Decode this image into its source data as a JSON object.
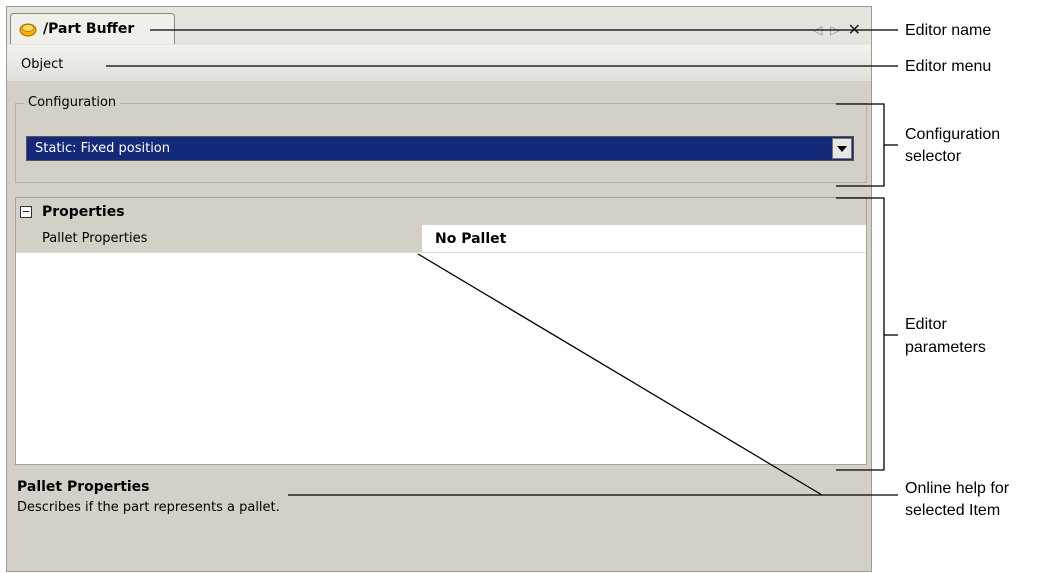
{
  "editor": {
    "tab_title": "/Part Buffer",
    "tab_icon": "buffer-icon",
    "menu": {
      "object_label": "Object"
    },
    "configuration": {
      "legend": "Configuration",
      "selected": "Static: Fixed position"
    },
    "properties": {
      "header": "Properties",
      "rows": [
        {
          "name": "Pallet Properties",
          "value": "No Pallet"
        }
      ]
    },
    "help": {
      "title": "Pallet Properties",
      "text": "Describes if the part represents a pallet."
    }
  },
  "annotations": {
    "editor_name": "Editor name",
    "editor_menu": "Editor menu",
    "config_selector_1": "Configuration",
    "config_selector_2": "selector",
    "editor_params_1": "Editor",
    "editor_params_2": "parameters",
    "online_help_1": "Online help for",
    "online_help_2": "selected Item"
  },
  "colors": {
    "selection": "#14297a",
    "panel": "#d4d0c8"
  }
}
